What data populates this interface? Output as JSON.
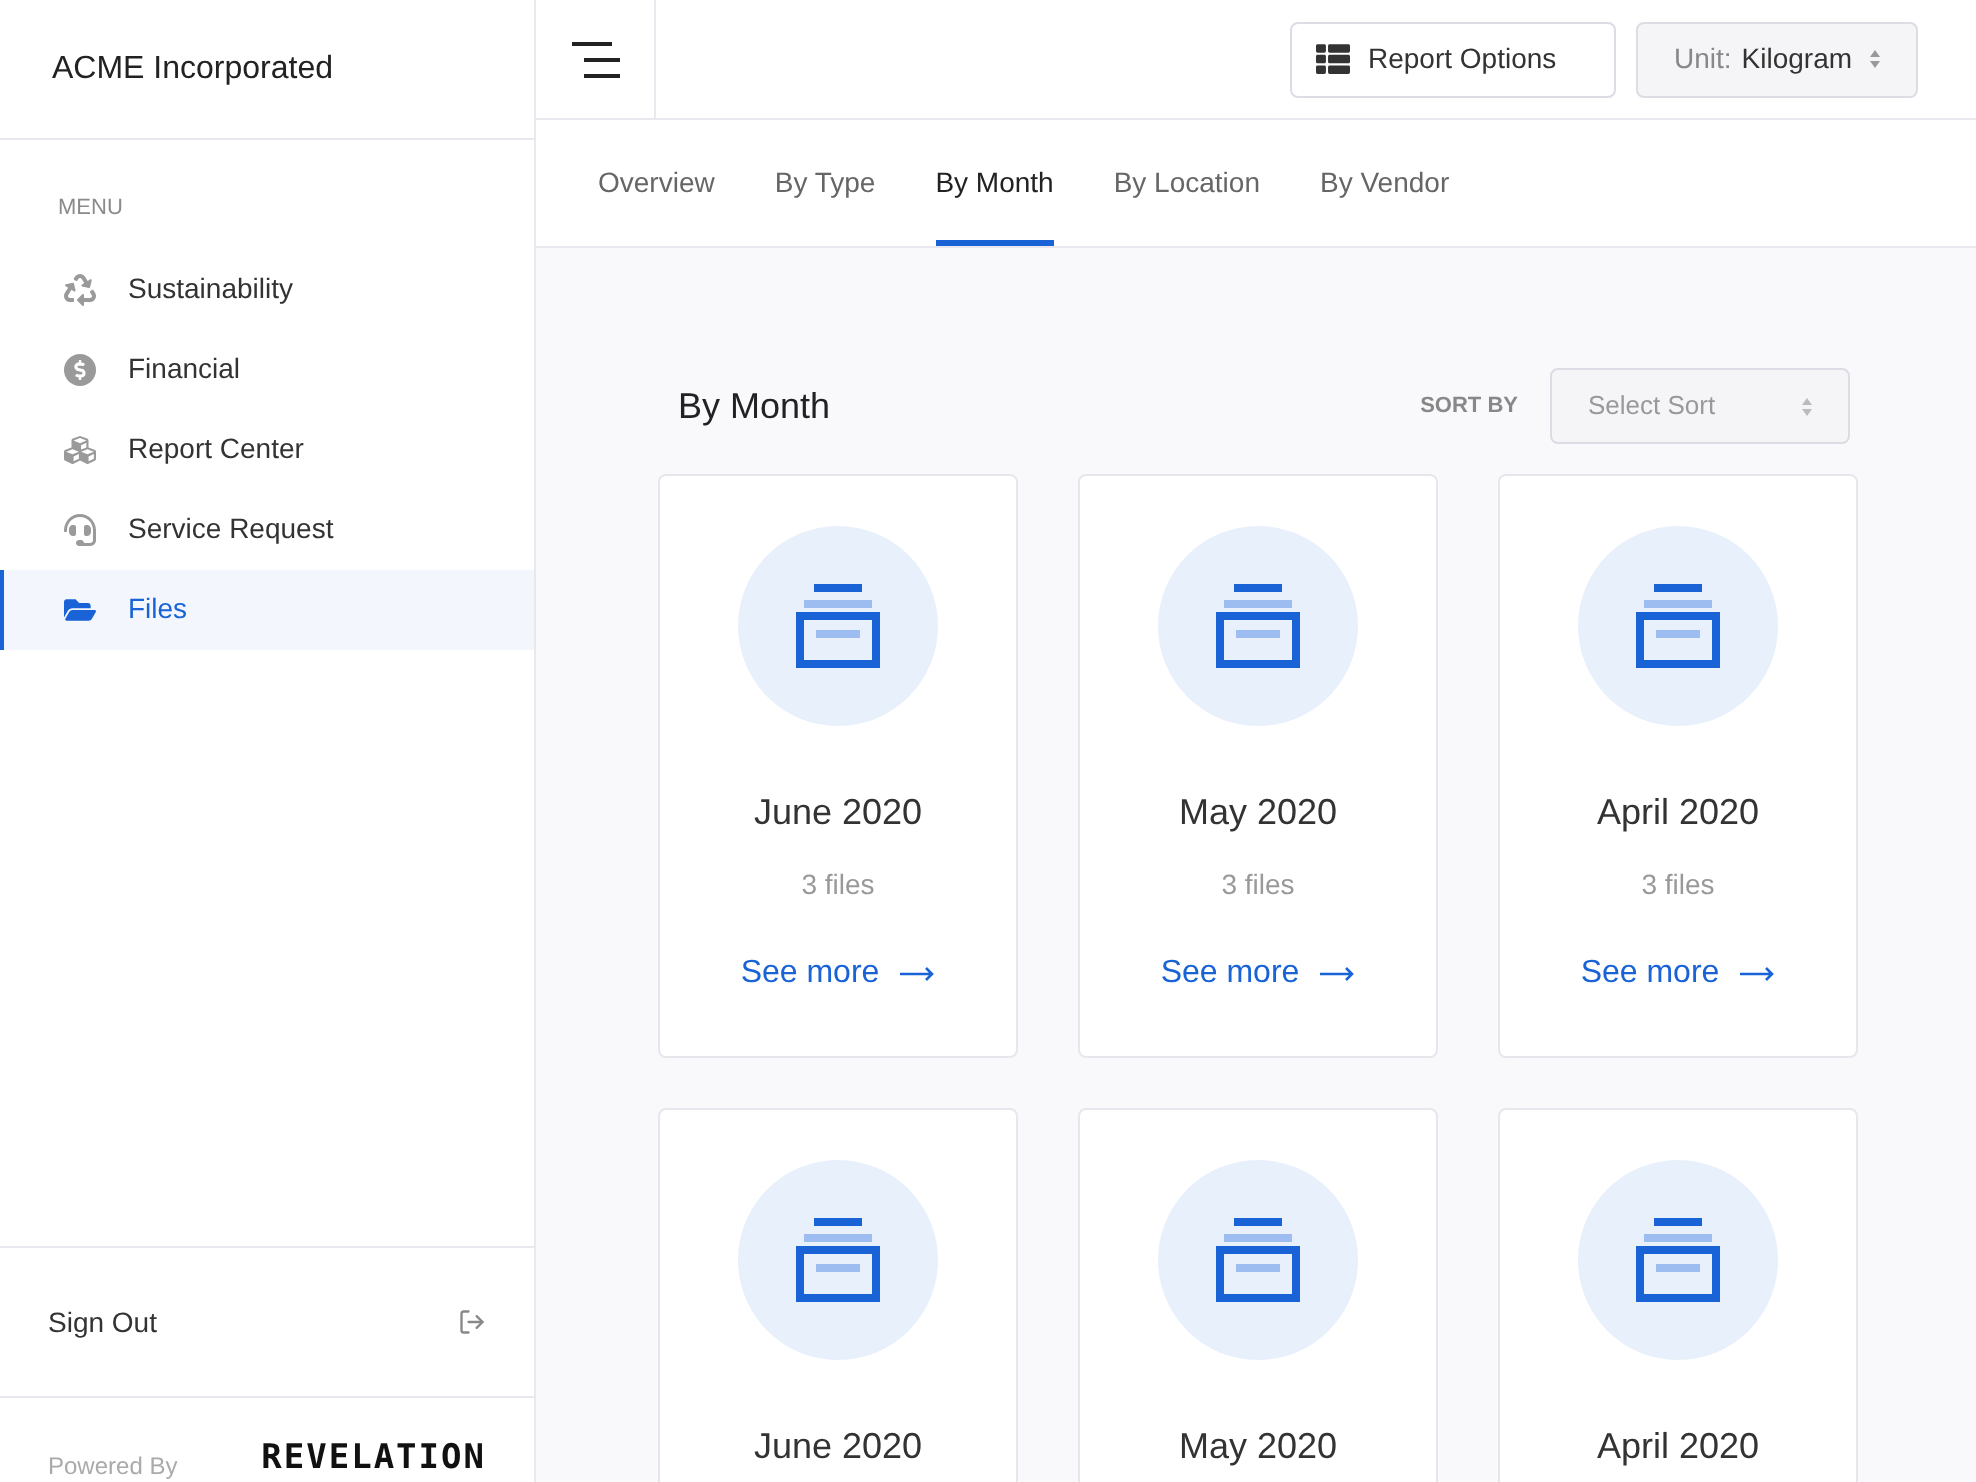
{
  "sidebar": {
    "company": "ACME Incorporated",
    "menu_label": "MENU",
    "items": [
      {
        "label": "Sustainability",
        "kind": "recycle",
        "selected": false
      },
      {
        "label": "Financial",
        "kind": "dollar",
        "selected": false
      },
      {
        "label": "Report Center",
        "kind": "cubes",
        "selected": false
      },
      {
        "label": "Service Request",
        "kind": "headset",
        "selected": false
      },
      {
        "label": "Files",
        "kind": "folder",
        "selected": true
      }
    ],
    "sign_out": "Sign Out",
    "powered_by": "Powered By",
    "logo": "REVELATION"
  },
  "header": {
    "report_options": "Report Options",
    "unit_label": "Unit:",
    "unit_value": "Kilogram"
  },
  "tabs": [
    {
      "label": "Overview",
      "selected": false
    },
    {
      "label": "By Type",
      "selected": false
    },
    {
      "label": "By Month",
      "selected": true
    },
    {
      "label": "By Location",
      "selected": false
    },
    {
      "label": "By Vendor",
      "selected": false
    }
  ],
  "section": {
    "title": "By Month",
    "sort_label": "SORT BY",
    "sort_placeholder": "Select Sort"
  },
  "cards": [
    {
      "title": "June 2020",
      "files": "3 files",
      "link": "See more"
    },
    {
      "title": "May 2020",
      "files": "3 files",
      "link": "See more"
    },
    {
      "title": "April 2020",
      "files": "3 files",
      "link": "See more"
    },
    {
      "title": "June 2020"
    },
    {
      "title": "May 2020"
    },
    {
      "title": "April 2020"
    }
  ]
}
